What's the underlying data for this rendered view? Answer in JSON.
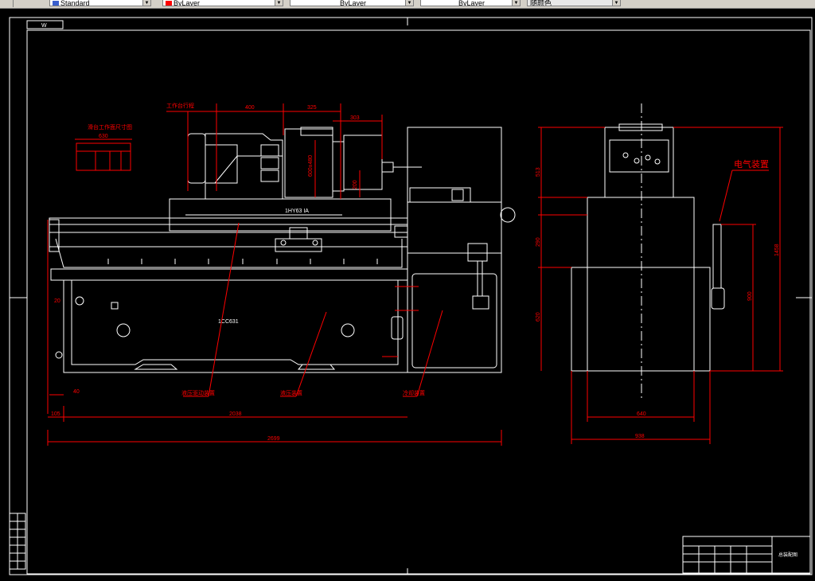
{
  "toolbar": {
    "textstyle": "Standard",
    "color": "ByLayer",
    "linetype": "ByLayer",
    "lineweight": "ByLayer",
    "plotstyle": "随颜色",
    "color_swatch": "#ff0000"
  },
  "drawing": {
    "frame_tag": "W",
    "machine_model": "1HY63 IA",
    "part_code": "1CC631",
    "electrical_label": "电气装置",
    "side_table_title": "滑台工作面尺寸图",
    "dims": {
      "d400": "400",
      "d325": "325",
      "d303": "303",
      "d630": "630",
      "d40": "40",
      "d105": "105",
      "d2038": "2038",
      "d2699": "2699",
      "d20": "20",
      "v600": "600±480",
      "v200": "200",
      "v513": "513",
      "v290": "290",
      "v620": "620",
      "v1458": "1458",
      "v900": "900",
      "h640": "640",
      "h938": "938"
    },
    "leaders": {
      "top_leader": "工作台行程",
      "bottom_left": "液压驱动装置",
      "bottom_mid": "液压装置",
      "bottom_right": "冷却装置"
    },
    "title_block_name": "总装配图"
  },
  "colors": {
    "line_white": "#ffffff",
    "line_red": "#ff0000",
    "background": "#000000"
  }
}
